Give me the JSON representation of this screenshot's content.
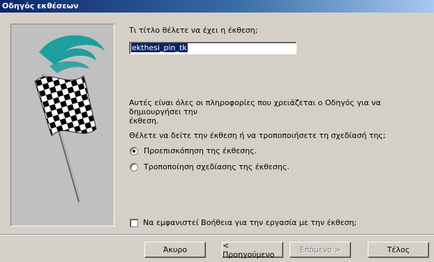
{
  "window": {
    "title": "Οδηγός εκθέσεων"
  },
  "illustration": {
    "icon": "checkered-flag-icon"
  },
  "prompt": {
    "question": "Τι τίτλο θέλετε να έχει η έκθεση;",
    "title_value": "ekthesi_pin_tk"
  },
  "info": {
    "line1": "Αυτές είναι όλες οι πληροφορίες που χρειάζεται ο Οδηγός για να δημιουργήσει την",
    "line2": "έκθεση.",
    "line3": "Θέλετε να δείτε την έκθεση ή να τροποποιήσετε τη σχεδίασή της;"
  },
  "options": {
    "preview": {
      "label": "Προεπισκόπηση της έκθεσης.",
      "checked": true
    },
    "modify": {
      "label": "Τροποποίηση σχεδίασης της έκθεσης.",
      "checked": false
    }
  },
  "help_checkbox": {
    "label": "Να εμφανιστεί Βοήθεια για την εργασία με την έκθεση;",
    "checked": false
  },
  "buttons": {
    "cancel": "Άκυρο",
    "back": "< Προηγούμενο",
    "next": "Επόμενο >",
    "finish": "Τέλος"
  }
}
